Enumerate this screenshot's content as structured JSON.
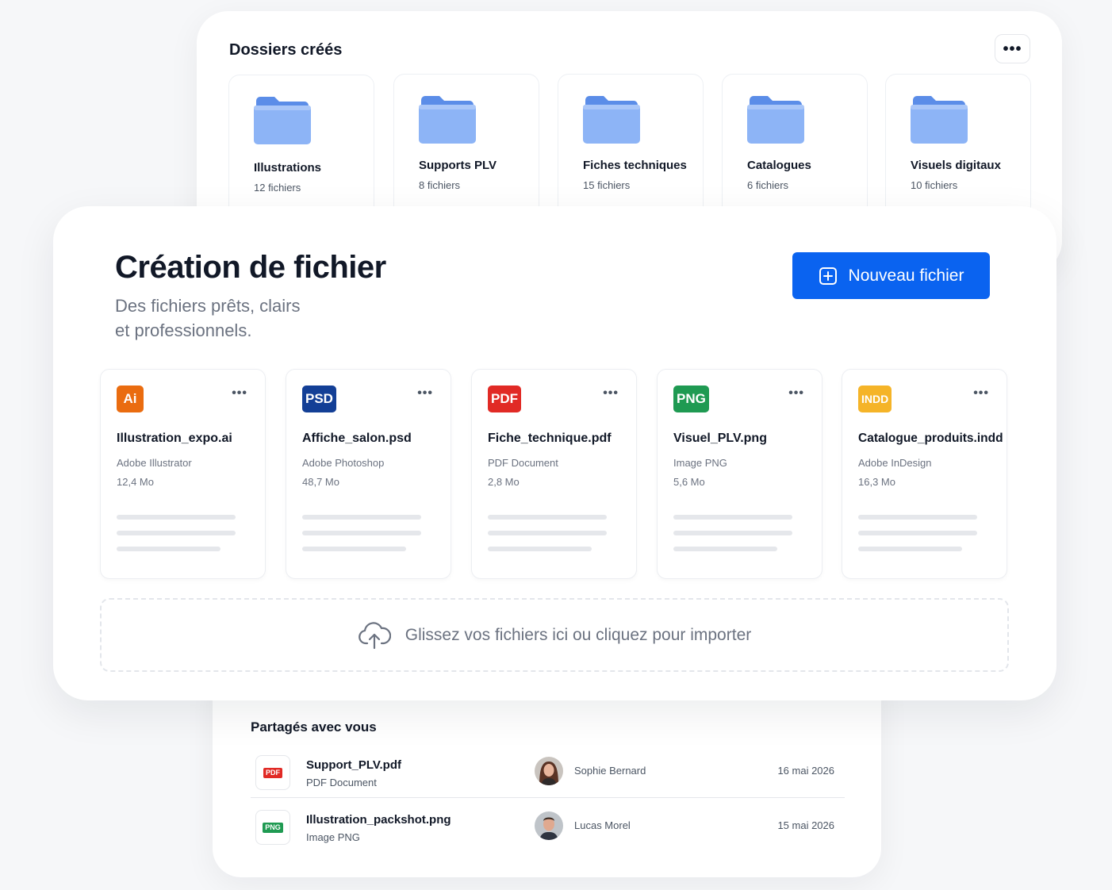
{
  "folders": {
    "title": "Dossiers créés",
    "more_label": "•••",
    "items": [
      {
        "name": "Illustrations",
        "count": "12 fichiers"
      },
      {
        "name": "Supports PLV",
        "count": "8 fichiers"
      },
      {
        "name": "Fiches techniques",
        "count": "15 fichiers"
      },
      {
        "name": "Catalogues",
        "count": "6 fichiers"
      },
      {
        "name": "Visuels digitaux",
        "count": "10 fichiers"
      }
    ]
  },
  "main": {
    "title": "Création de fichier",
    "subtitle_line1": "Des fichiers prêts, clairs",
    "subtitle_line2": "et professionnels.",
    "new_button_label": "Nouveau fichier",
    "more_label": "•••",
    "files": [
      {
        "badge": "Ai",
        "badge_color": "#ea6c10",
        "name": "Illustration_expo.ai",
        "app": "Adobe Illustrator",
        "size": "12,4 Mo"
      },
      {
        "badge": "PSD",
        "badge_color": "#133f96",
        "name": "Affiche_salon.psd",
        "app": "Adobe Photoshop",
        "size": "48,7 Mo"
      },
      {
        "badge": "PDF",
        "badge_color": "#e12a25",
        "name": "Fiche_technique.pdf",
        "app": "PDF Document",
        "size": "2,8 Mo"
      },
      {
        "badge": "PNG",
        "badge_color": "#1f9a52",
        "name": "Visuel_PLV.png",
        "app": "Image PNG",
        "size": "5,6 Mo"
      },
      {
        "badge": "INDD",
        "badge_color": "#f5b428",
        "name": "Catalogue_produits.indd",
        "app": "Adobe InDesign",
        "size": "16,3 Mo"
      }
    ],
    "dropzone_text": "Glissez vos fichiers ici ou cliquez pour importer"
  },
  "shared": {
    "title": "Partagés avec vous",
    "rows": [
      {
        "badge": "PDF",
        "badge_color": "#e12a25",
        "name": "Support_PLV.pdf",
        "type": "PDF Document",
        "user": "Sophie Bernard",
        "date": "16 mai 2026"
      },
      {
        "badge": "PNG",
        "badge_color": "#1f9a52",
        "name": "Illustration_packshot.png",
        "type": "Image PNG",
        "user": "Lucas Morel",
        "date": "15 mai 2026"
      }
    ]
  },
  "colors": {
    "accent": "#0a63f0",
    "folder_blue": "#7aa7f5"
  }
}
